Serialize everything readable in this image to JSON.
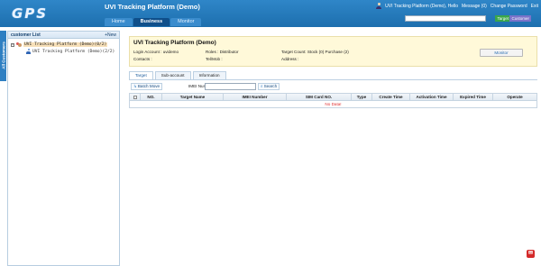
{
  "header": {
    "logo": "GPS",
    "title": "UVI Tracking Platform (Demo)",
    "nav": [
      "Home",
      "Business",
      "Monitor"
    ],
    "active_nav": "Business",
    "user": "UVI Tracking Platform (Demo), Hello",
    "message": "Message (0)",
    "change_password": "Change Password",
    "exit": "Exit",
    "target_button": "Target",
    "customer_button": "Customer"
  },
  "edge_tab": {
    "label": "All Customers"
  },
  "sidebar": {
    "title": "customer List",
    "new_label": "+New",
    "tree": [
      {
        "label": "UVI Tracking Platform (Demo)(0/2)",
        "toggle": "−"
      },
      {
        "label": "UVI Tracking Platform (Demo)(2/2)"
      }
    ]
  },
  "info": {
    "title": "UVI Tracking Platform (Demo)",
    "login_account": "Login Account : uvidemo",
    "roles": "Roles : Distributor",
    "target_count": "Target Count: Stock (0)  Purchase (2)",
    "contacts": "Contacts :",
    "tel": "Tel/Mob :",
    "address": "Address :",
    "monitor_button": "Monitor"
  },
  "tabs": [
    "Target",
    "Sub-account",
    "Information"
  ],
  "toolbar": {
    "batch_move": "Batch Move",
    "imei_label": "IMEI Number :",
    "search": "Search"
  },
  "table": {
    "columns": [
      "NO.",
      "Target Name",
      "IMEI Number",
      "SIM Card NO.",
      "Type",
      "Create Time",
      "Activation Time",
      "Expired Time",
      "Operate"
    ],
    "empty_text": "No Data!"
  },
  "corner": {
    "icon": "feedback-icon",
    "glyph": "✉"
  }
}
